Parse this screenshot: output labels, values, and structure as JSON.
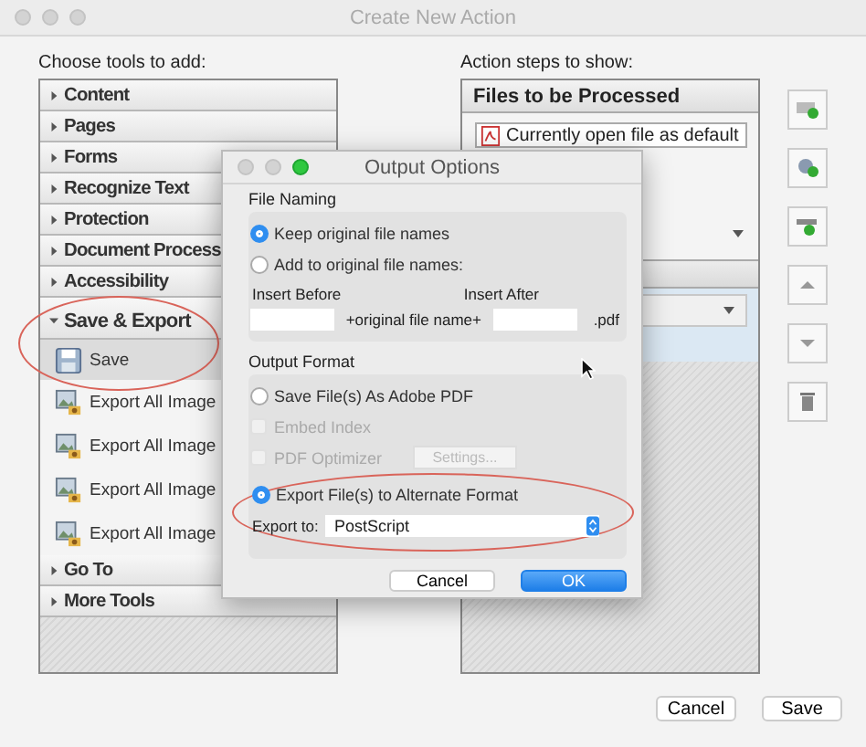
{
  "window": {
    "title": "Create New Action"
  },
  "tools_panel": {
    "label": "Choose tools to add:",
    "items": [
      {
        "label": "Content",
        "expanded": false
      },
      {
        "label": "Pages",
        "expanded": false
      },
      {
        "label": "Forms",
        "expanded": false
      },
      {
        "label": "Recognize Text",
        "expanded": false
      },
      {
        "label": "Protection",
        "expanded": false
      },
      {
        "label": "Document Process",
        "expanded": false
      },
      {
        "label": "Accessibility",
        "expanded": false
      },
      {
        "label": "Save & Export",
        "expanded": true,
        "children": [
          {
            "label": "Save",
            "kind": "save",
            "selected": true
          },
          {
            "label": "Export All Image",
            "kind": "export",
            "selected": false
          },
          {
            "label": "Export All Image",
            "kind": "export",
            "selected": false
          },
          {
            "label": "Export All Image",
            "kind": "export",
            "selected": false
          },
          {
            "label": "Export All Image",
            "kind": "export",
            "selected": false
          }
        ]
      },
      {
        "label": "Go To",
        "expanded": false
      },
      {
        "label": "More Tools",
        "expanded": false
      }
    ]
  },
  "steps_panel": {
    "label": "Action steps to show:",
    "header": "Files to be Processed",
    "file": "Currently open file as default"
  },
  "dialog": {
    "title": "Output Options",
    "file_naming": {
      "label": "File Naming",
      "options": [
        {
          "label": "Keep original file names",
          "selected": true
        },
        {
          "label": "Add to original file names:",
          "selected": false
        }
      ],
      "insert_before": "Insert Before",
      "insert_after": "Insert After",
      "middle": "+original file name+",
      "suffix": ".pdf"
    },
    "output_format": {
      "label": "Output Format",
      "options": [
        {
          "kind": "radio",
          "label": "Save File(s) As Adobe PDF",
          "selected": false
        },
        {
          "kind": "checkbox",
          "label": "Embed Index",
          "checked": false,
          "disabled": true
        },
        {
          "kind": "checkbox",
          "label": "PDF Optimizer",
          "checked": false,
          "disabled": true,
          "button": "Settings..."
        },
        {
          "kind": "radio",
          "label": "Export File(s) to Alternate Format",
          "selected": true
        }
      ],
      "export_to_label": "Export to:",
      "export_to_value": "PostScript"
    },
    "buttons": [
      {
        "label": "Cancel",
        "primary": false
      },
      {
        "label": "OK",
        "primary": true
      }
    ]
  },
  "footer_buttons": [
    "Cancel",
    "Save"
  ]
}
